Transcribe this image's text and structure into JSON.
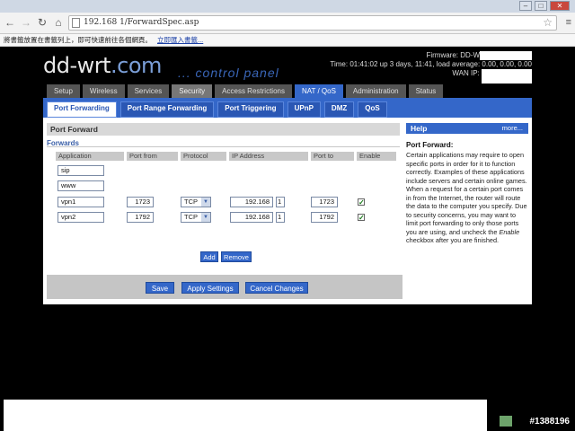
{
  "browser": {
    "url": "192.168   1/ForwardSpec.asp",
    "bookmark_text": "將書籤放置在書籤列上，即可快速前往各個網頁。",
    "bookmark_link": "立即匯入書籤..."
  },
  "header": {
    "logo_main": "dd-wrt",
    "logo_tld": ".com",
    "tagline": "... control panel",
    "firmware_label": "Firmware: DD-W",
    "time_info": "Time: 01:41:02 up 3 days, 11:41, load average: 0.00, 0.00, 0.00",
    "wan_ip_label": "WAN IP:"
  },
  "main_tabs": [
    {
      "label": "Setup"
    },
    {
      "label": "Wireless"
    },
    {
      "label": "Services"
    },
    {
      "label": "Security"
    },
    {
      "label": "Access Restrictions"
    },
    {
      "label": "NAT / QoS"
    },
    {
      "label": "Administration"
    },
    {
      "label": "Status"
    }
  ],
  "sub_tabs": [
    {
      "label": "Port Forwarding"
    },
    {
      "label": "Port Range Forwarding"
    },
    {
      "label": "Port Triggering"
    },
    {
      "label": "UPnP"
    },
    {
      "label": "DMZ"
    },
    {
      "label": "QoS"
    }
  ],
  "section": {
    "title": "Port Forward",
    "legend": "Forwards",
    "columns": [
      "Application",
      "Port from",
      "Protocol",
      "IP Address",
      "Port to",
      "Enable"
    ]
  },
  "forwards": [
    {
      "application": "sip"
    },
    {
      "application": "www"
    },
    {
      "application": "vpn1",
      "port_from": "1723",
      "protocol": "TCP",
      "ip": "192.168",
      "ip_last": "1",
      "port_to": "1723",
      "enabled": "✓"
    },
    {
      "application": "vpn2",
      "port_from": "1792",
      "protocol": "TCP",
      "ip": "192.168",
      "ip_last": "1",
      "port_to": "1792",
      "enabled": "✓"
    }
  ],
  "row_buttons": {
    "add": "Add",
    "remove": "Remove"
  },
  "footer_buttons": {
    "save": "Save",
    "apply": "Apply Settings",
    "cancel": "Cancel Changes"
  },
  "help": {
    "header": "Help",
    "more": "more...",
    "title": "Port Forward:",
    "text_1": "Certain applications may require to open specific ports in order for it to function correctly. Examples of these applications include servers and certain online games. When a request for a certain port comes in from the Internet, the router will route the data to the computer you specify. Due to security concerns, you may want to limit port forwarding to only those ports you are using, and uncheck the ",
    "text_em": "Enable",
    "text_2": " checkbox after you are finished."
  },
  "watermark": "#1388196"
}
